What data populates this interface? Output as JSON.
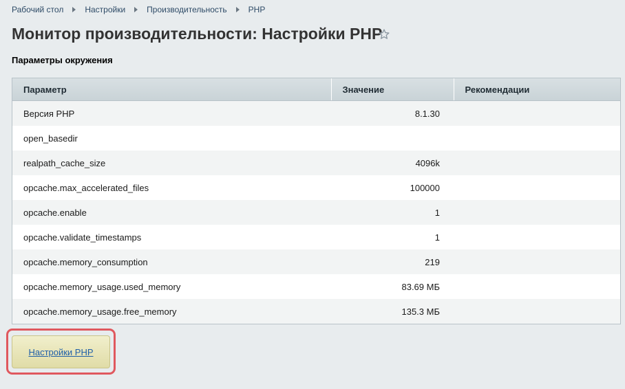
{
  "breadcrumb": {
    "items": [
      "Рабочий стол",
      "Настройки",
      "Производительность",
      "PHP"
    ]
  },
  "header": {
    "title": "Монитор производительности: Настройки PHP",
    "favorite_icon": "star-outline-icon"
  },
  "section": {
    "title": "Параметры окружения"
  },
  "table": {
    "columns": [
      "Параметр",
      "Значение",
      "Рекомендации"
    ],
    "rows": [
      {
        "param": "Версия PHP",
        "value": "8.1.30",
        "recommendation": ""
      },
      {
        "param": "open_basedir",
        "value": "",
        "recommendation": ""
      },
      {
        "param": "realpath_cache_size",
        "value": "4096k",
        "recommendation": ""
      },
      {
        "param": "opcache.max_accelerated_files",
        "value": "100000",
        "recommendation": ""
      },
      {
        "param": "opcache.enable",
        "value": "1",
        "recommendation": ""
      },
      {
        "param": "opcache.validate_timestamps",
        "value": "1",
        "recommendation": ""
      },
      {
        "param": "opcache.memory_consumption",
        "value": "219",
        "recommendation": ""
      },
      {
        "param": "opcache.memory_usage.used_memory",
        "value": "83.69 МБ",
        "recommendation": ""
      },
      {
        "param": "opcache.memory_usage.free_memory",
        "value": "135.3 МБ",
        "recommendation": ""
      }
    ]
  },
  "actions": {
    "php_settings_label": "Настройки PHP"
  },
  "colors": {
    "background": "#e8ecee",
    "highlight": "#e0585e",
    "link": "#1f5fa8"
  }
}
